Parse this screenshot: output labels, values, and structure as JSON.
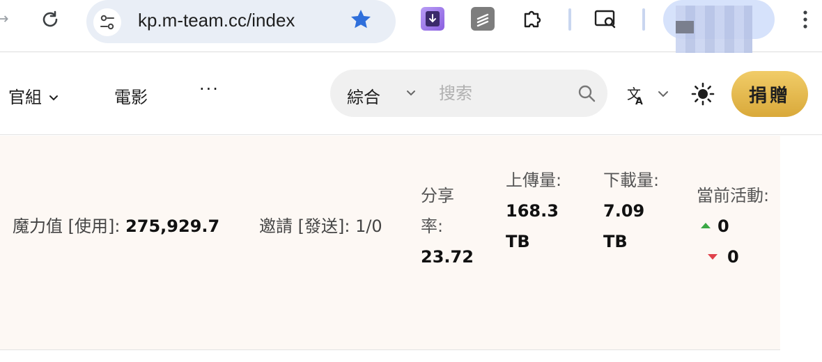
{
  "browser": {
    "url": "kp.m-team.cc/index",
    "icons": [
      "forward-icon",
      "reload-icon",
      "site-info-icon",
      "bookmark-star-icon",
      "extension-download-icon",
      "extension-s-icon",
      "extensions-puzzle-icon",
      "search-tab-icon",
      "profile-avatar",
      "kebab-menu-icon"
    ],
    "accent": "#2f6fdb"
  },
  "nav": {
    "official": "官組",
    "movies": "電影",
    "more": "···"
  },
  "search": {
    "category": "綜合",
    "placeholder": "搜索"
  },
  "header": {
    "donate_label": "捐贈"
  },
  "stats": {
    "magic_label": "魔力值 [使用]: ",
    "magic_value": "275,929.7",
    "invite_label": "邀請 [發送]: ",
    "invite_value": "1/0",
    "ratio_label": "分享率:",
    "ratio_value": "23.72",
    "upload_label": "上傳量:",
    "upload_value": "168.3 TB",
    "download_label": "下載量:",
    "download_value": "7.09 TB",
    "active_label": "當前活動:",
    "active_up": "0",
    "active_down": "0"
  },
  "colors": {
    "donate": "#e4b84f",
    "panel_bg": "#fdf8f4",
    "up_arrow": "#3aa845",
    "down_arrow": "#e0414b"
  }
}
